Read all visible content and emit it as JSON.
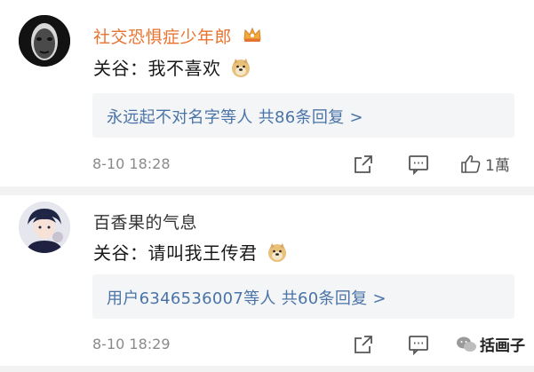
{
  "comments": [
    {
      "username": "社交恐惧症少年郎",
      "text": "关谷：我不喜欢",
      "reply_summary": "永远起不对名字等人  共86条回复 >",
      "timestamp": "8-10 18:28",
      "like_count": "1萬"
    },
    {
      "username": "百香果的气息",
      "text": "关谷：请叫我王传君",
      "reply_summary": "用户6346536007等人  共60条回复 >",
      "timestamp": "8-10 18:29"
    }
  ],
  "watermark": "括画子",
  "colors": {
    "vip_name": "#e8732f",
    "link_blue": "#4a73a8",
    "reply_bg": "#f4f5f6",
    "timestamp_gray": "#8a8a8a"
  },
  "icons": [
    "crown-badge-icon",
    "doge-emoji-icon",
    "share-icon",
    "comment-icon",
    "like-icon",
    "wechat-icon"
  ]
}
